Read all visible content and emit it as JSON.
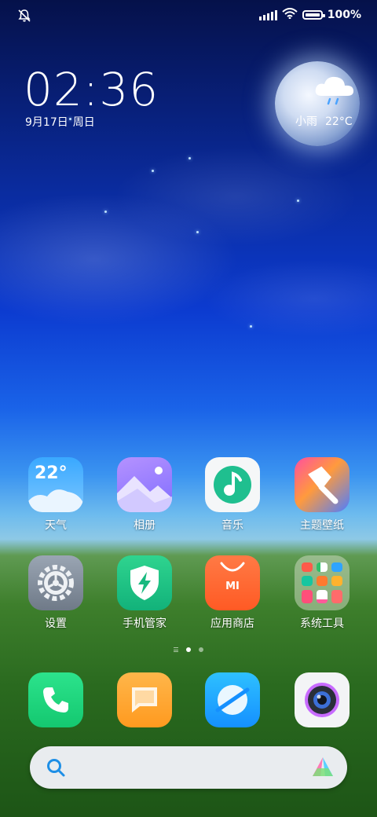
{
  "status_bar": {
    "left_icon": "mute-bell-icon",
    "battery_percent": "100%",
    "battery_level": 1.0,
    "icons": [
      "signal-icon",
      "wifi-icon",
      "battery-icon"
    ]
  },
  "clock": {
    "time": "02:36",
    "date": "9月17日",
    "weekday": "周日"
  },
  "weather": {
    "condition": "小雨",
    "temperature": "22°C",
    "icon": "rain-cloud-icon"
  },
  "apps": [
    {
      "label": "天气",
      "icon": "weather-app-icon",
      "badge_text": "22°"
    },
    {
      "label": "相册",
      "icon": "gallery-icon"
    },
    {
      "label": "音乐",
      "icon": "music-icon"
    },
    {
      "label": "主题壁纸",
      "icon": "themes-icon"
    },
    {
      "label": "设置",
      "icon": "settings-gear-icon"
    },
    {
      "label": "手机管家",
      "icon": "security-shield-icon"
    },
    {
      "label": "应用商店",
      "icon": "app-store-icon",
      "badge_text": "MI"
    },
    {
      "label": "系统工具",
      "icon": "tools-folder-icon"
    }
  ],
  "page_indicator": {
    "pages": 2,
    "current": 1
  },
  "dock": [
    {
      "icon": "phone-icon"
    },
    {
      "icon": "messages-icon"
    },
    {
      "icon": "browser-icon"
    },
    {
      "icon": "camera-icon"
    }
  ],
  "search": {
    "icon": "search-icon",
    "assistant_icon": "assistant-icon"
  },
  "colors": {
    "accent": "#1e6fd9",
    "search_bg": "#e9ecef"
  }
}
